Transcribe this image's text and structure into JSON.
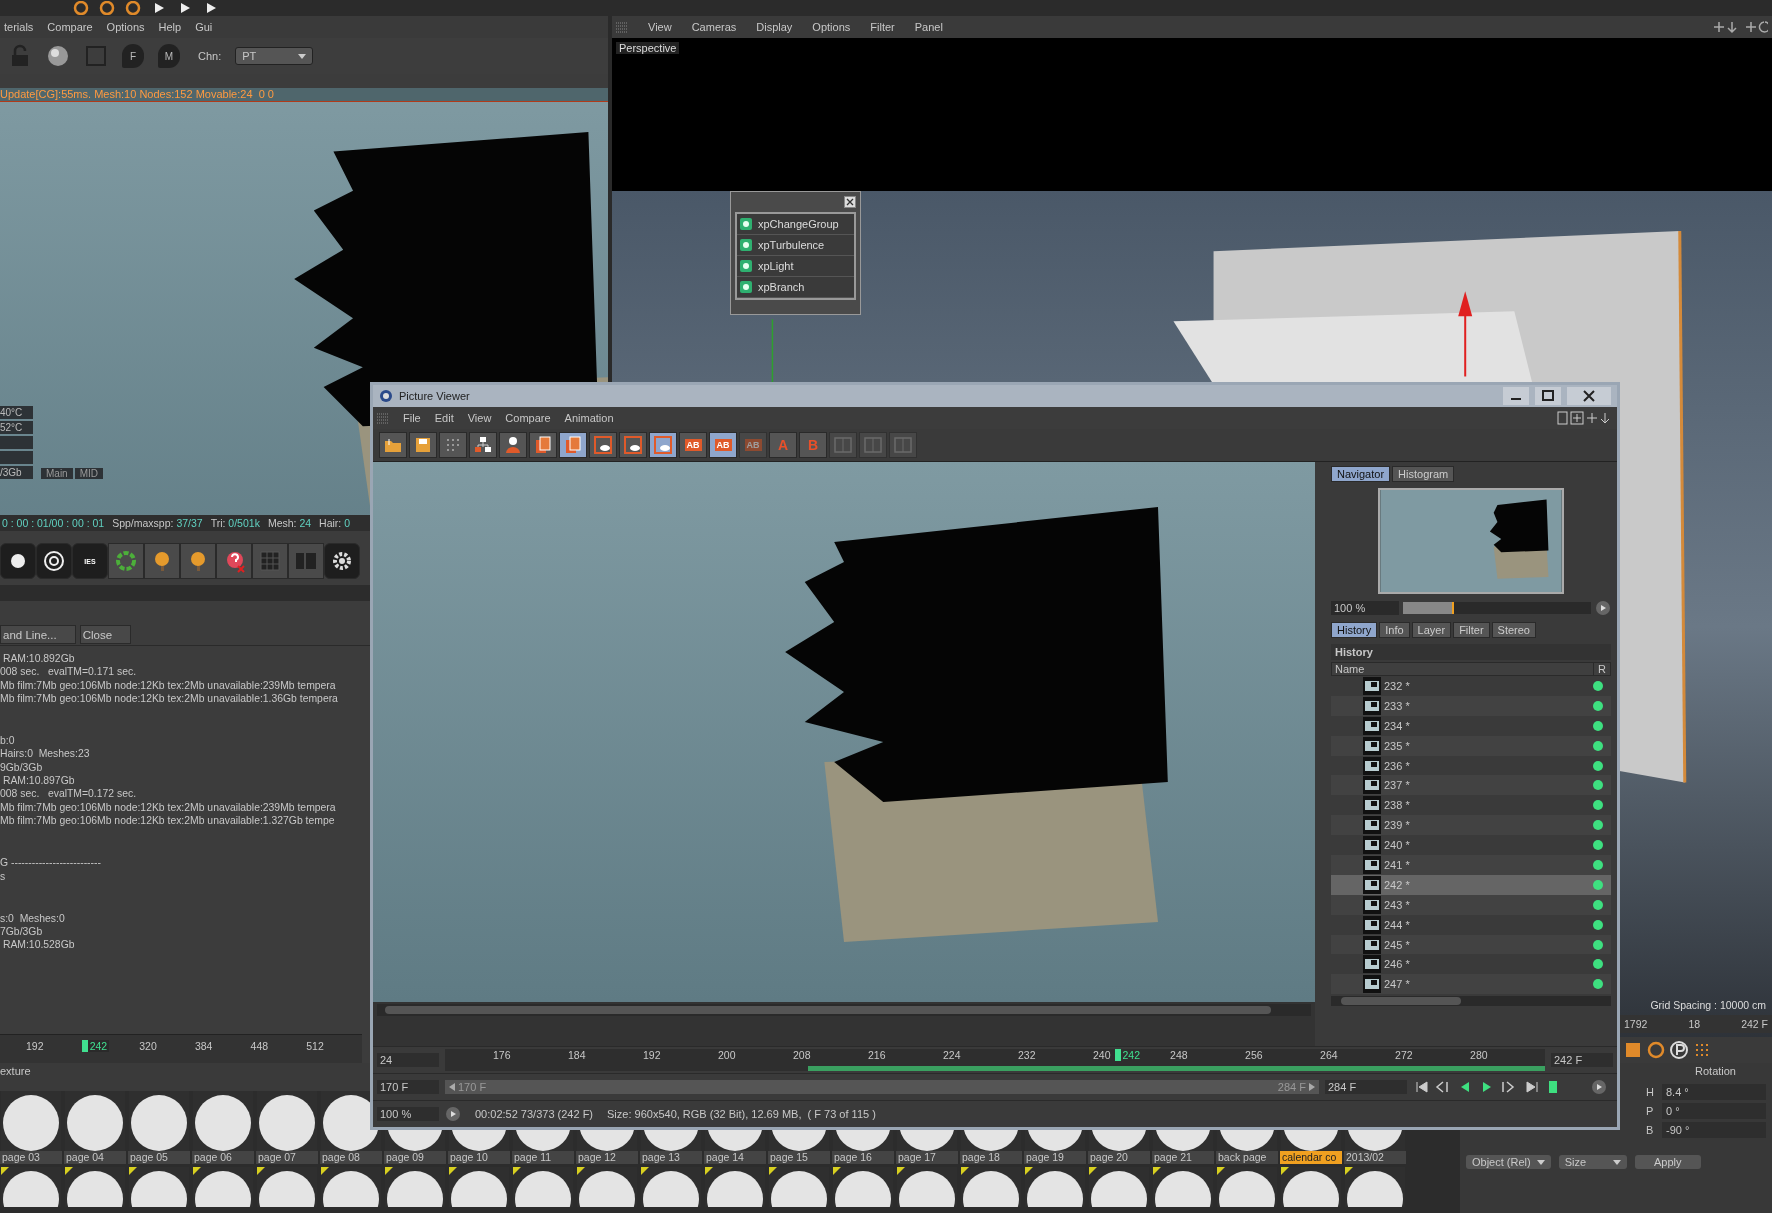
{
  "left_panel": {
    "menu": [
      "terials",
      "Compare",
      "Options",
      "Help",
      "Gui"
    ],
    "toolbar": {
      "icons": [
        {
          "kind": "lock"
        },
        {
          "kind": "sphere"
        },
        {
          "kind": "square"
        },
        {
          "kind": "pin",
          "label": "F"
        },
        {
          "kind": "pin",
          "label": "M"
        }
      ],
      "channel_label": "Chn:",
      "channel_value": "PT"
    },
    "status": "Update[CG]:55ms. Mesh:10 Nodes:152 Movable:24  0 0",
    "overlay": {
      "readouts": [
        "40°C",
        "52°C"
      ],
      "memory": "/3Gb",
      "tabs": [
        "Main",
        "MID"
      ]
    },
    "stats": {
      "time": "0 : 00 : 01/00 : 00 : 01",
      "items": [
        {
          "label": "Spp/maxspp:",
          "value": "37/37"
        },
        {
          "label": "Tri:",
          "value": "0/501k"
        },
        {
          "label": "Mesh:",
          "value": "24"
        },
        {
          "label": "Hair:",
          "value": "0"
        }
      ]
    },
    "render_tools": [
      {
        "kind": "disc"
      },
      {
        "kind": "target"
      },
      {
        "kind": "lamp",
        "label": "IES"
      },
      {
        "kind": "ring"
      },
      {
        "kind": "tree"
      },
      {
        "kind": "tree"
      },
      {
        "kind": "help"
      },
      {
        "kind": "grid"
      },
      {
        "kind": "panel"
      },
      {
        "kind": "gear"
      }
    ],
    "console": {
      "buttons": [
        "and Line...",
        "Close"
      ],
      "groups": [
        [
          " RAM:10.892Gb",
          "008 sec.   evalTM=0.171 sec.",
          "Mb film:7Mb geo:106Mb node:12Kb tex:2Mb unavailable:239Mb tempera",
          "Mb film:7Mb geo:106Mb node:12Kb tex:2Mb unavailable:1.36Gb tempera"
        ],
        [
          "b:0",
          "Hairs:0  Meshes:23",
          "9Gb/3Gb",
          " RAM:10.897Gb",
          "008 sec.   evalTM=0.172 sec.",
          "Mb film:7Mb geo:106Mb node:12Kb tex:2Mb unavailable:239Mb tempera",
          "Mb film:7Mb geo:106Mb node:12Kb tex:2Mb unavailable:1.327Gb tempe"
        ],
        [
          "G --------------------------",
          "s"
        ],
        [
          "s:0  Meshes:0",
          "7Gb/3Gb",
          " RAM:10.528Gb"
        ]
      ]
    },
    "timeline": {
      "ticks": [
        {
          "label": "192",
          "selected": false
        },
        {
          "label": "242",
          "selected": true
        },
        {
          "label": "320",
          "selected": false
        },
        {
          "label": "384",
          "selected": false
        },
        {
          "label": "448",
          "selected": false
        },
        {
          "label": "512",
          "selected": false
        }
      ]
    }
  },
  "right_viewport": {
    "menu": [
      "View",
      "Cameras",
      "Display",
      "Options",
      "Filter",
      "Panel"
    ],
    "camera": "Perspective",
    "grid_spacing": "Grid Spacing : 10000 cm",
    "timeline": [
      "1792",
      "18",
      "242 F"
    ]
  },
  "node_popup": {
    "items": [
      "xpChangeGroup",
      "xpTurbulence",
      "xpLight",
      "xpBranch"
    ]
  },
  "picture_viewer": {
    "title": "Picture Viewer",
    "menu": [
      "File",
      "Edit",
      "View",
      "Compare",
      "Animation"
    ],
    "toolbar": [
      {
        "kind": "folder",
        "selected": false,
        "disabled": false
      },
      {
        "kind": "disk",
        "selected": false,
        "disabled": false
      },
      {
        "kind": "grid",
        "selected": false,
        "disabled": false
      },
      {
        "kind": "hierarchy",
        "selected": false,
        "disabled": false
      },
      {
        "kind": "person",
        "selected": false,
        "disabled": false
      },
      {
        "kind": "layers",
        "selected": false,
        "disabled": false
      },
      {
        "kind": "layers",
        "selected": true,
        "disabled": false
      },
      {
        "kind": "frame",
        "selected": false,
        "disabled": false
      },
      {
        "kind": "frame",
        "selected": false,
        "disabled": false
      },
      {
        "kind": "frame",
        "selected": true,
        "disabled": false
      },
      {
        "kind": "ab",
        "label": "AB",
        "selected": false,
        "disabled": false
      },
      {
        "kind": "ab",
        "label": "AB",
        "selected": true,
        "disabled": false
      },
      {
        "kind": "ab",
        "label": "AB",
        "selected": false,
        "disabled": true
      },
      {
        "kind": "letter",
        "label": "A",
        "selected": false,
        "disabled": false
      },
      {
        "kind": "letter",
        "label": "B",
        "selected": false,
        "disabled": false
      },
      {
        "kind": "split",
        "selected": false,
        "disabled": true
      },
      {
        "kind": "split",
        "selected": false,
        "disabled": true
      },
      {
        "kind": "split",
        "selected": false,
        "disabled": true
      }
    ],
    "navigator": {
      "tabs": [
        {
          "label": "Navigator",
          "selected": true
        },
        {
          "label": "Histogram",
          "selected": false
        }
      ],
      "zoom": "100 %",
      "zoom_slider": {
        "level": 0.26
      }
    },
    "history": {
      "tabs": [
        {
          "label": "History",
          "selected": true
        },
        {
          "label": "Info",
          "selected": false
        },
        {
          "label": "Layer",
          "selected": false
        },
        {
          "label": "Filter",
          "selected": false
        },
        {
          "label": "Stereo",
          "selected": false
        }
      ],
      "heading": "History",
      "columns": [
        "Name",
        "R"
      ],
      "rows": [
        {
          "name": "232 *",
          "selected": false
        },
        {
          "name": "233 *",
          "selected": false
        },
        {
          "name": "234 *",
          "selected": false
        },
        {
          "name": "235 *",
          "selected": false
        },
        {
          "name": "236 *",
          "selected": false
        },
        {
          "name": "237 *",
          "selected": false
        },
        {
          "name": "238 *",
          "selected": false
        },
        {
          "name": "239 *",
          "selected": false
        },
        {
          "name": "240 *",
          "selected": false
        },
        {
          "name": "241 *",
          "selected": false
        },
        {
          "name": "242 *",
          "selected": true
        },
        {
          "name": "243 *",
          "selected": false
        },
        {
          "name": "244 *",
          "selected": false
        },
        {
          "name": "245 *",
          "selected": false
        },
        {
          "name": "246 *",
          "selected": false
        },
        {
          "name": "247 *",
          "selected": false
        }
      ]
    },
    "timeline": {
      "start_field": "24",
      "ticks": [
        {
          "label": "176",
          "selected": false
        },
        {
          "label": "184",
          "selected": false
        },
        {
          "label": "192",
          "selected": false
        },
        {
          "label": "200",
          "selected": false
        },
        {
          "label": "208",
          "selected": false
        },
        {
          "label": "216",
          "selected": false
        },
        {
          "label": "224",
          "selected": false
        },
        {
          "label": "232",
          "selected": false
        },
        {
          "label": "240",
          "selected": false
        },
        {
          "label": "242",
          "selected": true
        },
        {
          "label": "248",
          "selected": false
        },
        {
          "label": "256",
          "selected": false
        },
        {
          "label": "264",
          "selected": false
        },
        {
          "label": "272",
          "selected": false
        },
        {
          "label": "280",
          "selected": false
        }
      ],
      "rendered": {
        "level": 0.67
      },
      "end_field": "242 F",
      "range_start_field": "170 F",
      "range_start": "170 F",
      "range_end": "284 F",
      "range_end_field": "284 F",
      "zoom": "100 %",
      "time": "00:02:52 73/373 (242 F)",
      "info": "Size: 960x540, RGB (32 Bit), 12.69 MB,  ( F 73 of 115 )"
    }
  },
  "materials": {
    "label": "exture",
    "items": [
      {
        "name": "page 03",
        "selected": false
      },
      {
        "name": "page 04",
        "selected": false
      },
      {
        "name": "page 05",
        "selected": false
      },
      {
        "name": "page 06",
        "selected": false
      },
      {
        "name": "page 07",
        "selected": false
      },
      {
        "name": "page 08",
        "selected": false
      },
      {
        "name": "page 09",
        "selected": false
      },
      {
        "name": "page 10",
        "selected": false
      },
      {
        "name": "page 11",
        "selected": false
      },
      {
        "name": "page 12",
        "selected": false
      },
      {
        "name": "page 13",
        "selected": false
      },
      {
        "name": "page 14",
        "selected": false
      },
      {
        "name": "page 15",
        "selected": false
      },
      {
        "name": "page 16",
        "selected": false
      },
      {
        "name": "page 17",
        "selected": false
      },
      {
        "name": "page 18",
        "selected": false
      },
      {
        "name": "page 19",
        "selected": false
      },
      {
        "name": "page 20",
        "selected": false
      },
      {
        "name": "page 21",
        "selected": false
      },
      {
        "name": "back page",
        "selected": false
      },
      {
        "name": "calendar co",
        "selected": true
      },
      {
        "name": "2013/02",
        "selected": false
      }
    ]
  },
  "attributes": {
    "heading": "Rotation",
    "fields": [
      {
        "label": "H",
        "value": "8.4 °"
      },
      {
        "label": "P",
        "value": "0 °"
      },
      {
        "label": "B",
        "value": "-90 °"
      }
    ],
    "coord_mode": "Object (Rel)",
    "size_mode": "Size",
    "apply": "Apply"
  }
}
